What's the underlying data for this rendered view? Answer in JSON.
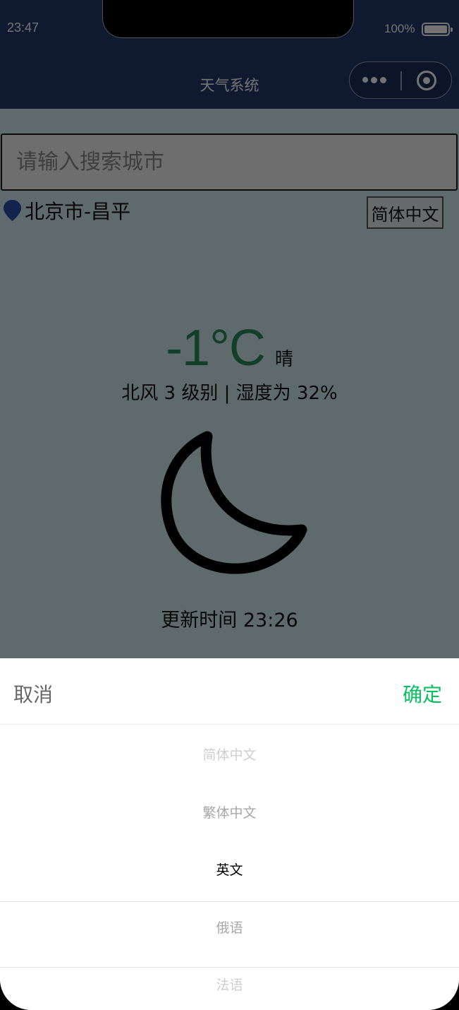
{
  "status_bar": {
    "time": "23:47",
    "battery": "100%"
  },
  "nav": {
    "title": "天气系统"
  },
  "search": {
    "placeholder": "请输入搜索城市"
  },
  "location": {
    "text": "北京市-昌平",
    "pin_color": "#2c4fa8"
  },
  "language_button": {
    "label": "简体中文"
  },
  "weather": {
    "temperature": "-1°C",
    "condition": "晴",
    "wind_humidity": "北风 3 级别 | 湿度为 32%",
    "icon": "moon-icon",
    "update_time": "更新时间 23:26",
    "temperature_color": "#2c8a5a"
  },
  "picker": {
    "cancel_label": "取消",
    "confirm_label": "确定",
    "confirm_color": "#07c160",
    "options": [
      "简体中文",
      "繁体中文",
      "英文",
      "俄语",
      "法语"
    ],
    "selected": "英文"
  }
}
